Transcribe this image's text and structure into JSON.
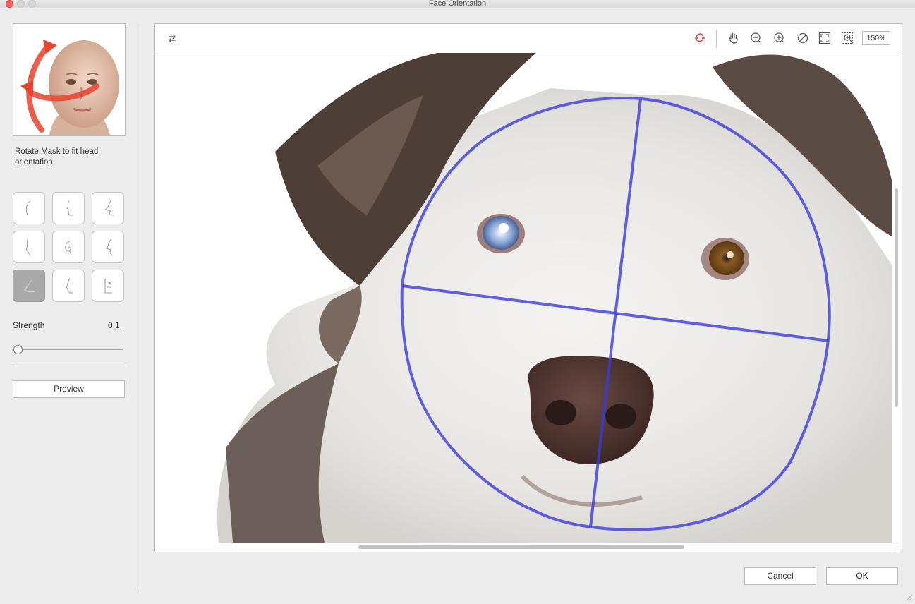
{
  "window": {
    "title": "Face Orientation"
  },
  "sidebar": {
    "instruction": "Rotate Mask to fit head orientation.",
    "orientation_buttons": [
      {
        "icon": "profile-left-up-icon",
        "active": false
      },
      {
        "icon": "profile-front-up-icon",
        "active": false
      },
      {
        "icon": "profile-right-up-icon",
        "active": false
      },
      {
        "icon": "profile-left-icon",
        "active": false
      },
      {
        "icon": "profile-front-icon",
        "active": false
      },
      {
        "icon": "profile-right-icon",
        "active": false
      },
      {
        "icon": "profile-left-down-icon",
        "active": true
      },
      {
        "icon": "profile-front-down-icon",
        "active": false
      },
      {
        "icon": "profile-right-down-icon",
        "active": false
      }
    ],
    "strength": {
      "label": "Strength",
      "value": "0.1",
      "level": 0.0
    },
    "preview_label": "Preview"
  },
  "toolbar": {
    "zoom_label": "150%",
    "tools": [
      "swap-icon",
      "rotate-mask-icon",
      "pan-hand-icon",
      "zoom-out-icon",
      "zoom-in-icon",
      "reset-icon",
      "fit-icon",
      "zoom-region-icon"
    ]
  },
  "footer": {
    "cancel_label": "Cancel",
    "ok_label": "OK"
  },
  "colors": {
    "accent_red": "#e03c31",
    "mask_blue": "#3b3bdc"
  }
}
